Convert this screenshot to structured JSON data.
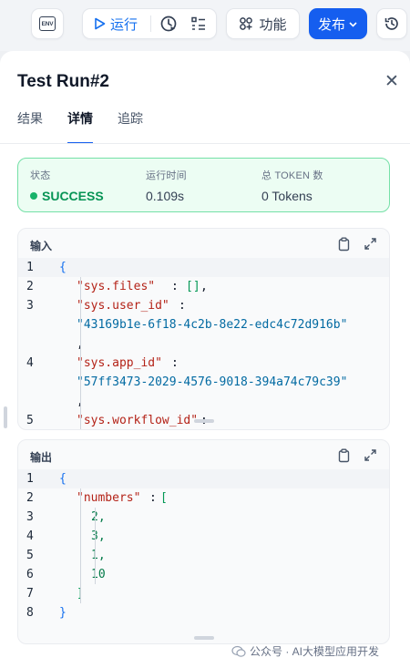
{
  "toolbar": {
    "env_label": "ENV",
    "run_label": "运行",
    "features_label": "功能",
    "publish_label": "发布"
  },
  "panel": {
    "title": "Test Run#2",
    "tabs": [
      "结果",
      "详情",
      "追踪"
    ],
    "active_tab": "详情"
  },
  "status": {
    "state_label": "状态",
    "state_value": "SUCCESS",
    "time_label": "运行时间",
    "time_value": "0.109s",
    "tokens_label": "总 TOKEN 数",
    "tokens_value": "0 Tokens",
    "success_color": "#079455"
  },
  "input": {
    "title": "输入",
    "line_numbers": [
      "1",
      "2",
      "3",
      "4",
      "5"
    ],
    "open_brace": "{",
    "files_key": "\"sys.files\"",
    "files_value": "[]",
    "user_id_key": "\"sys.user_id\"",
    "user_id_value": "\"43169b1e-6f18-4c2b-8e22-edc4c72d916b\"",
    "app_id_key": "\"sys.app_id\"",
    "app_id_value": "\"57ff3473-2029-4576-9018-394a74c79c39\"",
    "workflow_id_key": "\"sys.workflow_id\"",
    "comma": ",",
    "colon": ":"
  },
  "output": {
    "title": "输出",
    "line_numbers": [
      "1",
      "2",
      "3",
      "4",
      "5",
      "6",
      "7",
      "8"
    ],
    "open_brace": "{",
    "numbers_key": "\"numbers\"",
    "open_bracket": "[",
    "values": [
      "2,",
      "3,",
      "1,",
      "10"
    ],
    "close_bracket": "]",
    "close_brace": "}",
    "colon": ":"
  },
  "watermark": "公众号 · AI大模型应用开发"
}
